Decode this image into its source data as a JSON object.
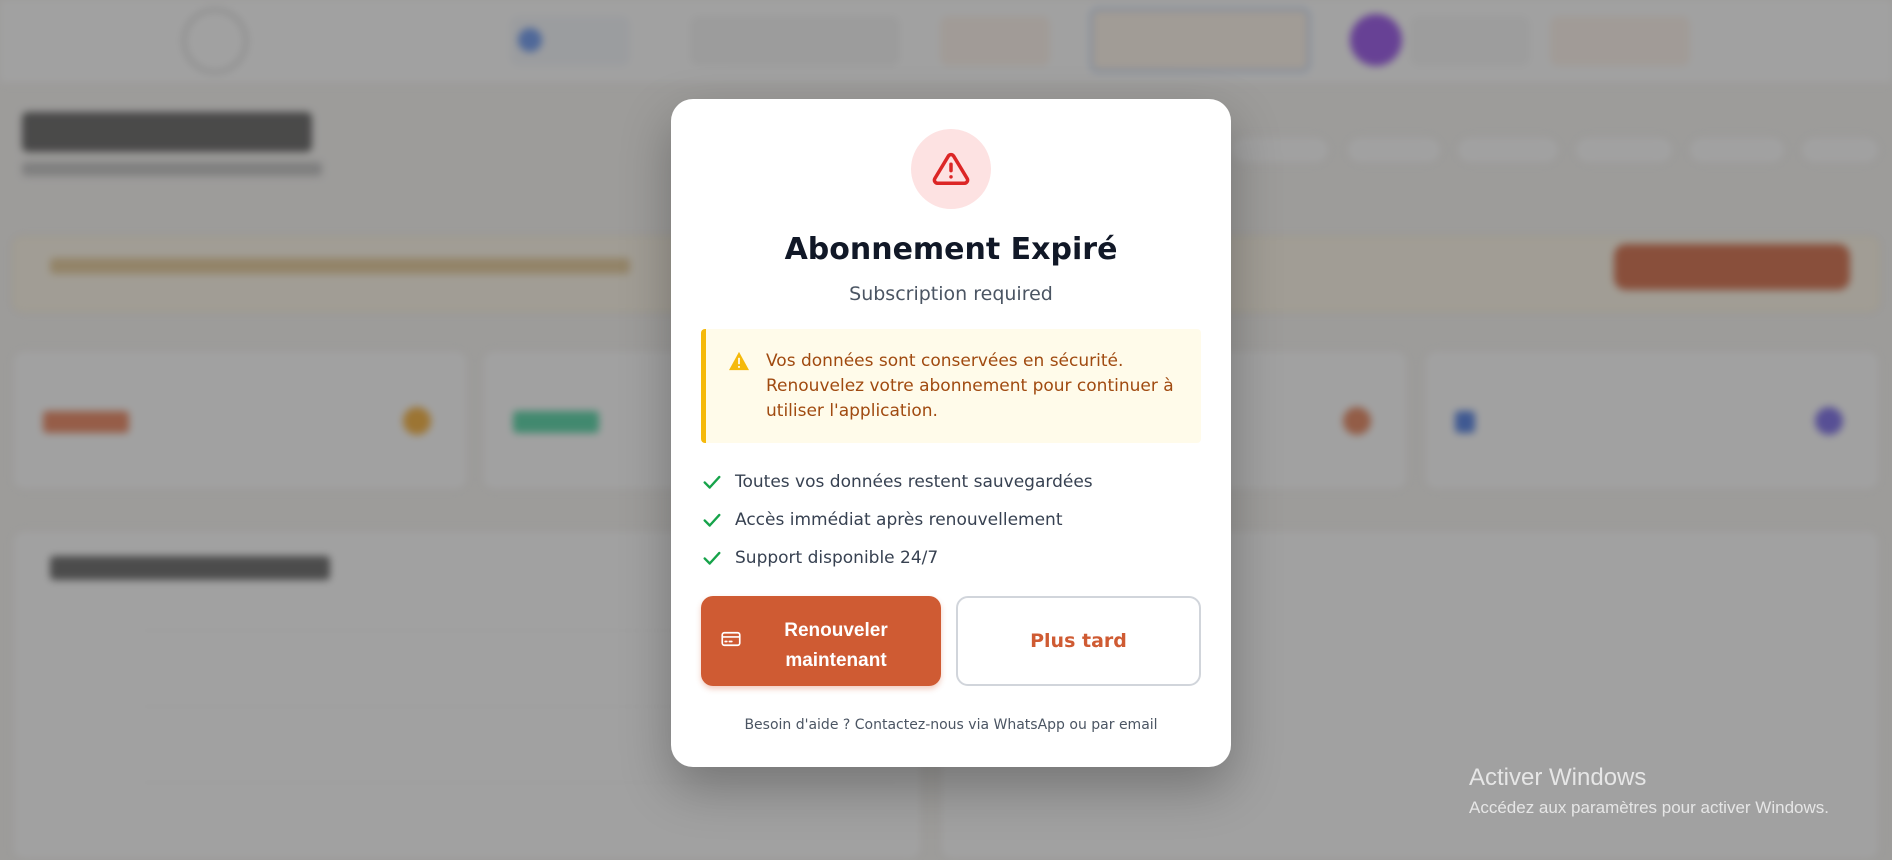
{
  "modal": {
    "title": "Abonnement Expiré",
    "subtitle": "Subscription required",
    "notice": "Vos données sont conservées en sécurité. Renouvelez votre abonnement pour continuer à utiliser l'application.",
    "features": [
      "Toutes vos données restent sauvegardées",
      "Accès immédiat après renouvellement",
      "Support disponible 24/7"
    ],
    "renew_label": "Renouveler maintenant",
    "later_label": "Plus tard",
    "help_text": "Besoin d'aide ? Contactez-nous via WhatsApp ou par email"
  },
  "windows_watermark": {
    "title": "Activer Windows",
    "subtitle": "Accédez aux paramètres pour activer Windows."
  },
  "colors": {
    "primary": "#cf5b33",
    "danger": "#dc2626",
    "danger_bg": "#fde2e2",
    "warning_border": "#f5b90b",
    "warning_bg": "#fffbea",
    "warning_text": "#a04a10",
    "check": "#16a34a",
    "overlay": "#444444"
  },
  "icons": {
    "modal": "warning-triangle-icon",
    "notice": "warning-triangle-icon",
    "features": "check-icon",
    "renew": "credit-card-icon"
  }
}
